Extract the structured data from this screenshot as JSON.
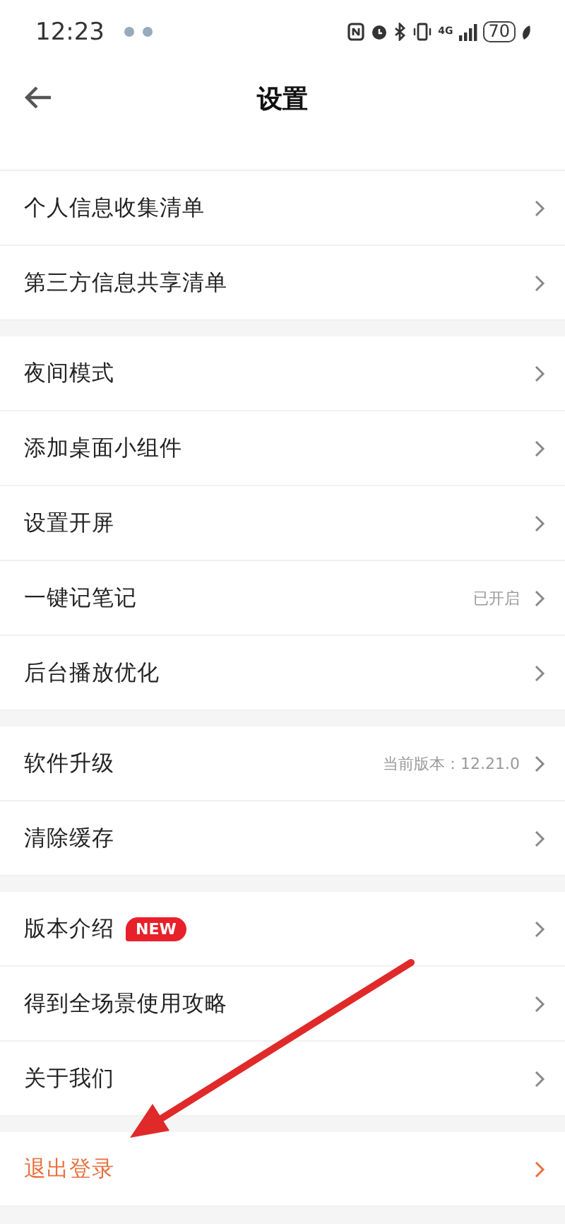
{
  "status_bar": {
    "time": "12:23",
    "network": "4G",
    "battery": "70"
  },
  "header": {
    "title": "设置"
  },
  "groups": [
    {
      "items": [
        {
          "kind": "nav",
          "label": "个人信息收集清单"
        },
        {
          "kind": "nav",
          "label": "第三方信息共享清单"
        }
      ]
    },
    {
      "items": [
        {
          "kind": "nav",
          "label": "夜间模式"
        },
        {
          "kind": "nav",
          "label": "添加桌面小组件"
        },
        {
          "kind": "nav",
          "label": "设置开屏"
        },
        {
          "kind": "nav",
          "label": "一键记笔记",
          "value": "已开启"
        },
        {
          "kind": "nav",
          "label": "后台播放优化"
        }
      ]
    },
    {
      "items": [
        {
          "kind": "nav",
          "label": "软件升级",
          "value": "当前版本：12.21.0"
        },
        {
          "kind": "nav",
          "label": "清除缓存"
        }
      ]
    },
    {
      "items": [
        {
          "kind": "nav",
          "label": "版本介绍",
          "badge": "NEW"
        },
        {
          "kind": "nav",
          "label": "得到全场景使用攻略"
        },
        {
          "kind": "nav",
          "label": "关于我们"
        }
      ]
    },
    {
      "items": [
        {
          "kind": "logout",
          "label": "退出登录"
        }
      ]
    }
  ]
}
